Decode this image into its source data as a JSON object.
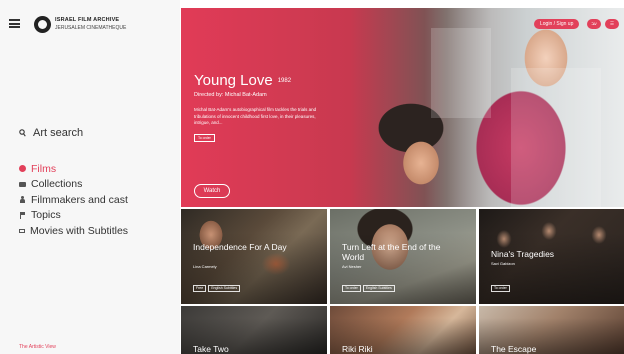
{
  "brand": {
    "line1": "ISRAEL FILM ARCHIVE",
    "line2": "JERUSALEM CINEMATHEQUE"
  },
  "sidebar": {
    "search_label": "Art search",
    "items": [
      {
        "label": "Films",
        "icon": "dot-icon",
        "active": true
      },
      {
        "label": "Collections",
        "icon": "folder-icon"
      },
      {
        "label": "Filmmakers and cast",
        "icon": "person-icon"
      },
      {
        "label": "Topics",
        "icon": "flag-icon"
      },
      {
        "label": "Movies with Subtitles",
        "icon": "subtitles-icon"
      }
    ],
    "footer": "The Artistic View"
  },
  "header": {
    "login_label": "Login / Sign up",
    "lang_label": "עב",
    "menu_label": "☰"
  },
  "hero": {
    "title": "Young Love",
    "year": "1982",
    "director": "Directed by: Michal Bat-Adam",
    "description": "Michal Bat-Adam's autobiographical film tackles the trials and tribulations of innocent childhood first love, in their pleasures, intrigue, and...",
    "tag": "To order",
    "watch_label": "Watch"
  },
  "tiles": [
    {
      "title": "Independence For A Day",
      "sub": "Lina Carmely",
      "tags": [
        "Free",
        "English Subtitles"
      ]
    },
    {
      "title": "Turn Left at the End of the World",
      "sub": "Avi Nesher",
      "tags": [
        "To order",
        "English Subtitles"
      ]
    },
    {
      "title": "Nina's Tragedies",
      "sub": "Savi Gabizon",
      "tags": [
        "To order"
      ]
    },
    {
      "title": "Take Two",
      "sub": "",
      "tags": []
    },
    {
      "title": "Riki Riki",
      "sub": "",
      "tags": []
    },
    {
      "title": "The Escape",
      "sub": "",
      "tags": []
    }
  ],
  "colors": {
    "accent": "#e2405a"
  }
}
